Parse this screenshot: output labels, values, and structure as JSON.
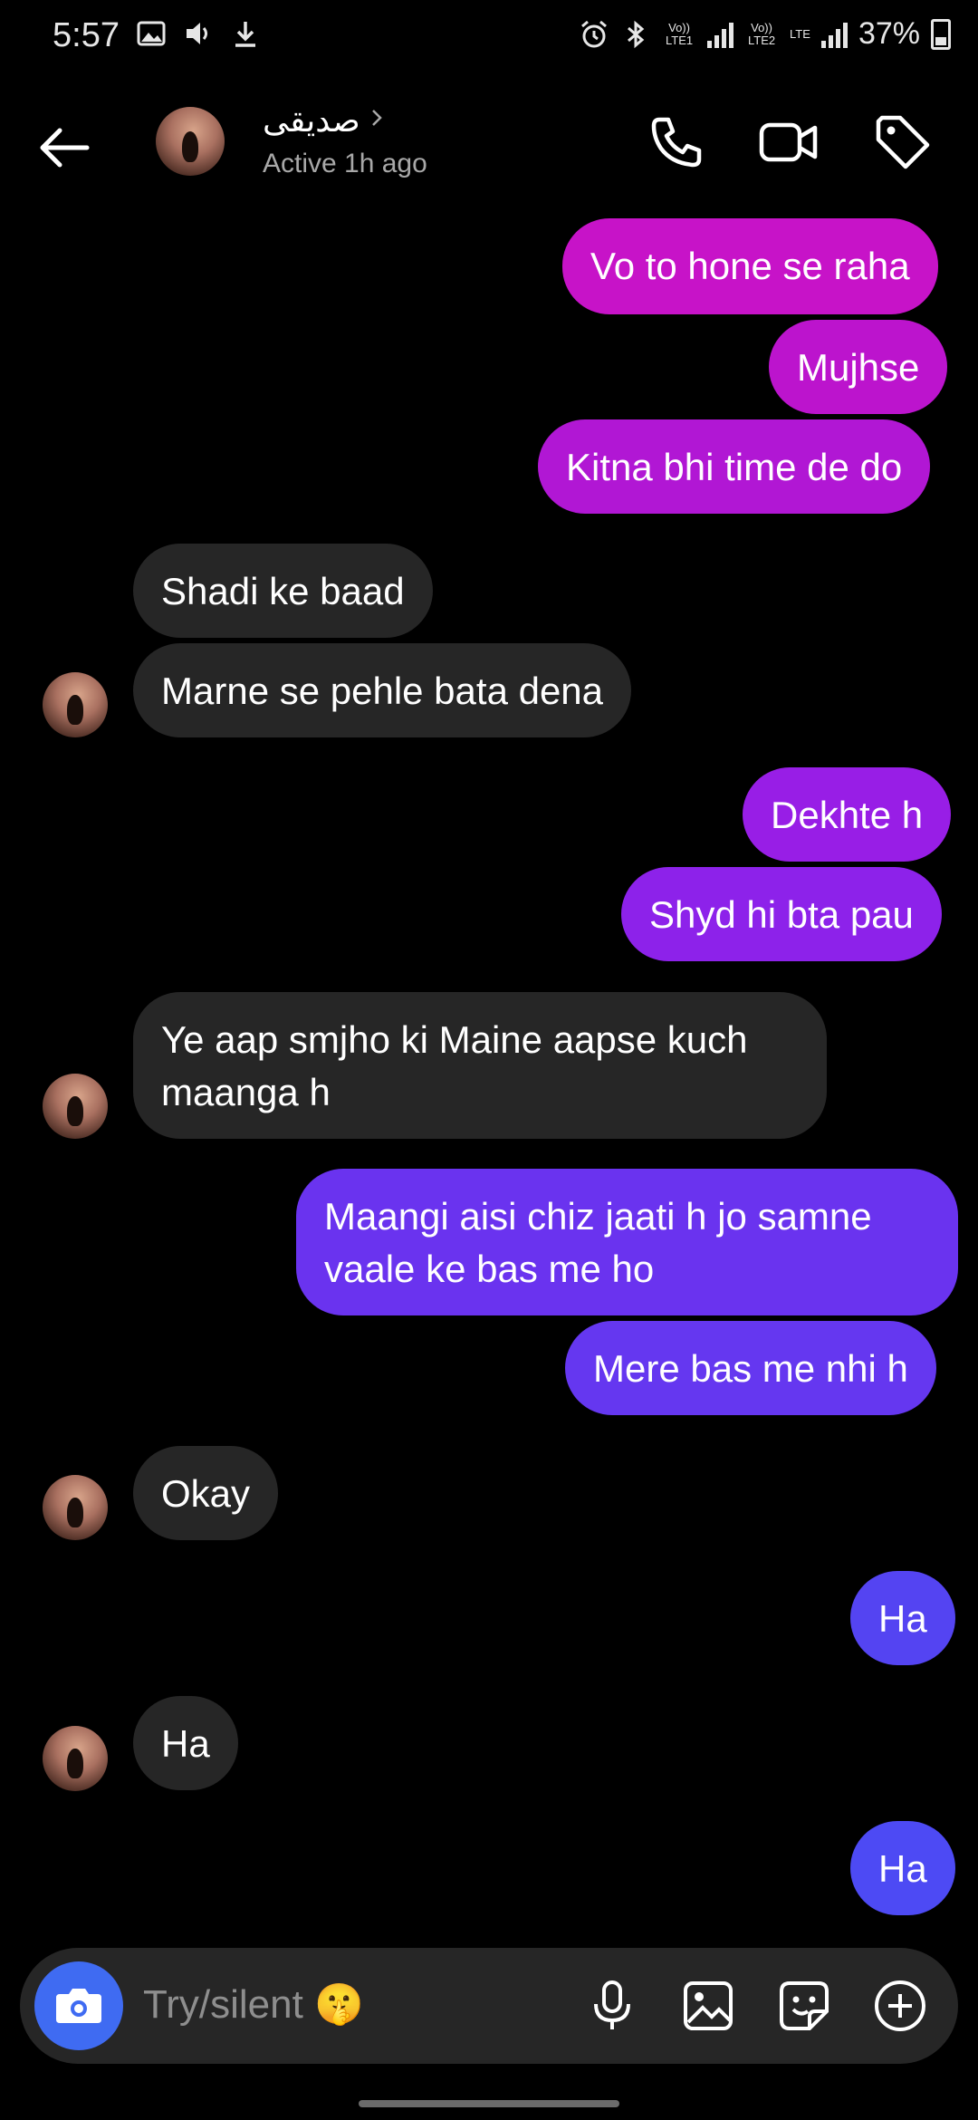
{
  "status_bar": {
    "time": "5:57",
    "battery": "37%",
    "sim1": "Vo)) LTE1",
    "sim2": "Vo)) LTE2",
    "lte": "LTE"
  },
  "header": {
    "contact_name": "صديقى",
    "active_status": "Active 1h ago"
  },
  "messages": [
    {
      "text": "Vo to hone se raha",
      "side": "sent"
    },
    {
      "text": "Mujhse",
      "side": "sent"
    },
    {
      "text": "Kitna bhi time de do",
      "side": "sent"
    },
    {
      "text": "Shadi ke baad",
      "side": "received"
    },
    {
      "text": "Marne se pehle bata dena",
      "side": "received"
    },
    {
      "text": "Dekhte h",
      "side": "sent"
    },
    {
      "text": "Shyd hi bta pau",
      "side": "sent"
    },
    {
      "text": "Ye aap smjho ki Maine aapse kuch maanga h",
      "side": "received"
    },
    {
      "text": "Maangi aisi chiz jaati h jo samne vaale ke bas me ho",
      "side": "sent"
    },
    {
      "text": "Mere bas me nhi h",
      "side": "sent"
    },
    {
      "text": "Okay",
      "side": "received"
    },
    {
      "text": "Ha",
      "side": "sent"
    },
    {
      "text": "Ha",
      "side": "received"
    },
    {
      "text": "Ha",
      "side": "sent"
    }
  ],
  "composer": {
    "placeholder": "Try/silent 🤫"
  },
  "colors": {
    "sent_gradient_top": "#c513c8",
    "sent_gradient_bottom": "#4d55f5",
    "received_bubble": "#262626",
    "camera_button": "#3f6bf2"
  }
}
